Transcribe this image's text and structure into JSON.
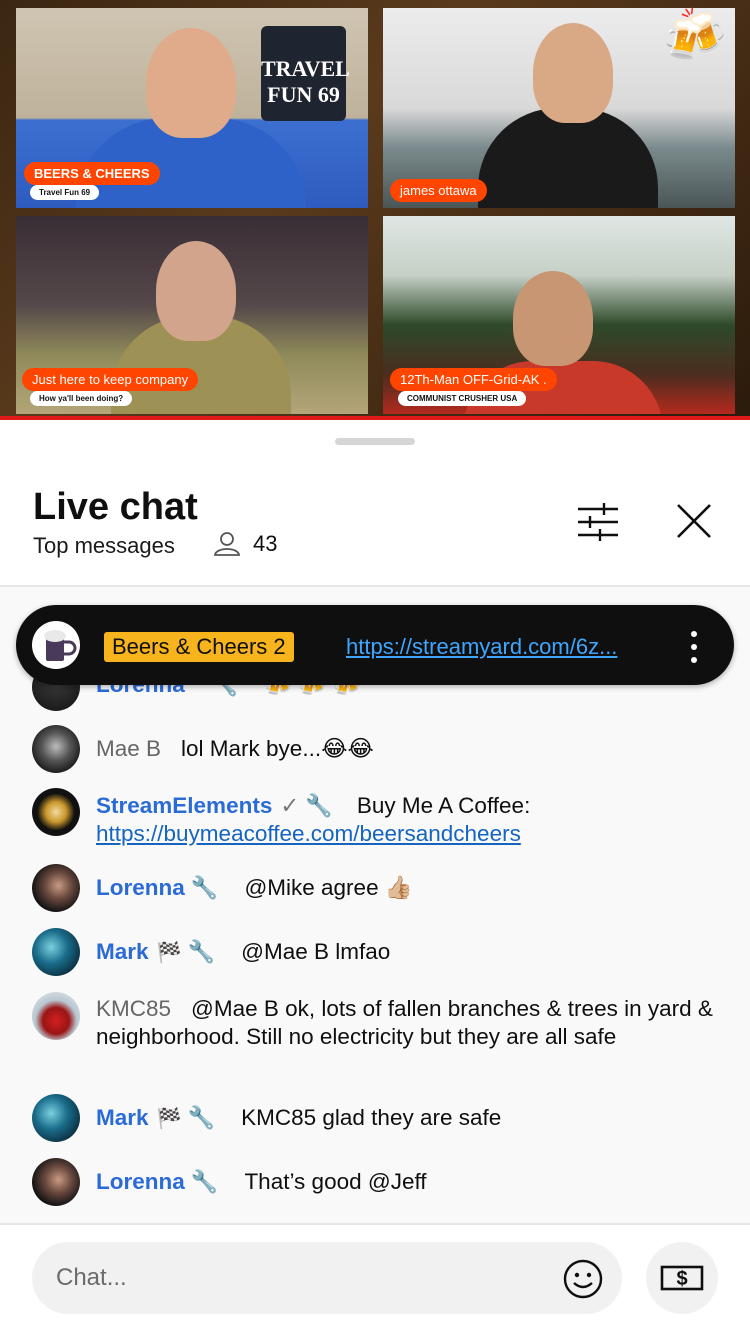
{
  "video": {
    "tiles": [
      {
        "label": "BEERS & CHEERS",
        "sublabel": "Travel Fun 69"
      },
      {
        "label": "james ottawa"
      },
      {
        "label": "Just here to keep company",
        "sublabel": "How ya'll been doing?"
      },
      {
        "label": "12Th-Man OFF-Grid-AK .",
        "sublabel": "COMMUNIST CRUSHER USA"
      }
    ],
    "jersey_text": "TRAVEL FUN 69",
    "beer_emoji": "🍻"
  },
  "header": {
    "title": "Live chat",
    "subtitle": "Top messages",
    "viewer_count": "43"
  },
  "pinned": {
    "name": "Beers & Cheers 2",
    "link": "https://streamyard.com/6z..."
  },
  "messages": [
    {
      "author": "Lorenna",
      "text": "🍻 🍻 🍻",
      "wrench": "🔧"
    },
    {
      "author": "Mae B",
      "text": "lol Mark bye...😂😂"
    },
    {
      "author": "StreamElements",
      "check": "✓",
      "wrench": "🔧",
      "text": "Buy Me A Coffee: ",
      "link": "https://buymeacoffee.com/beersandcheers"
    },
    {
      "author": "Lorenna",
      "wrench": "🔧",
      "text": "@Mike agree 👍🏼"
    },
    {
      "author": "Mark",
      "flag": "🏁",
      "wrench": "🔧",
      "text": "@Mae B lmfao"
    },
    {
      "author": "KMC85",
      "text": "@Mae B ok, lots of fallen branches & trees in yard & neighborhood. Still no electricity but they are all safe"
    },
    {
      "author": "Mark",
      "flag": "🏁",
      "wrench": "🔧",
      "text": "KMC85 glad they are safe"
    },
    {
      "author": "Lorenna",
      "wrench": "🔧",
      "text": "That’s good @Jeff"
    }
  ],
  "input": {
    "placeholder": "Chat..."
  },
  "colors": {
    "accent_orange": "#ff4500",
    "moderator_blue": "#2a6bd6",
    "pinned_badge": "#f8b41c",
    "link_blue": "#3ea6ff"
  },
  "icons": [
    "tune-icon",
    "close-icon",
    "person-icon",
    "emoji-icon",
    "super-chat-dollar-icon",
    "more-vert-icon",
    "wrench-icon",
    "checkered-flag-icon"
  ]
}
